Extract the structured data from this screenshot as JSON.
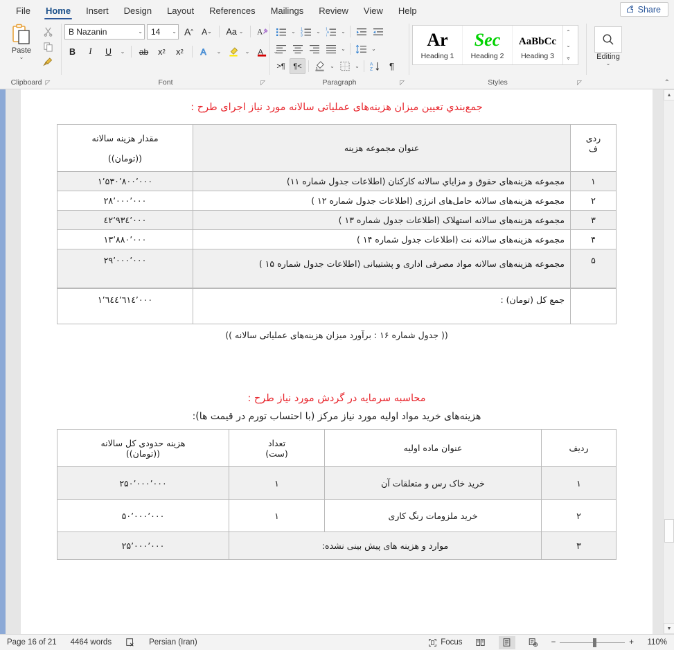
{
  "window": {
    "share_label": "Share",
    "share_icon": "share-person-icon"
  },
  "ribbon": {
    "tabs": [
      {
        "label": "File",
        "active": false
      },
      {
        "label": "Home",
        "active": true
      },
      {
        "label": "Insert",
        "active": false
      },
      {
        "label": "Design",
        "active": false
      },
      {
        "label": "Layout",
        "active": false
      },
      {
        "label": "References",
        "active": false
      },
      {
        "label": "Mailings",
        "active": false
      },
      {
        "label": "Review",
        "active": false
      },
      {
        "label": "View",
        "active": false
      },
      {
        "label": "Help",
        "active": false
      }
    ],
    "clipboard": {
      "group_label": "Clipboard",
      "paste_label": "Paste",
      "cut_icon": "scissors-icon",
      "copy_icon": "copy-icon",
      "format_painter_icon": "format-painter-icon",
      "dialog_launcher_icon": "dialog-launcher-icon"
    },
    "font": {
      "group_label": "Font",
      "font_name": "B Nazanin",
      "font_size": "14",
      "grow_font_icon": "grow-font-icon",
      "shrink_font_icon": "shrink-font-icon",
      "change_case_label": "Aa",
      "clear_formatting_icon": "clear-formatting-icon",
      "bold_label": "B",
      "italic_label": "I",
      "underline_label": "U",
      "strikethrough_label": "ab",
      "subscript_label": "x",
      "superscript_label": "x",
      "text_effects_icon": "text-effects-icon",
      "highlight_icon": "highlight-color-icon",
      "font_color_icon": "font-color-icon",
      "highlight_color": "#ffe900",
      "font_color": "#d40000",
      "dialog_launcher_icon": "dialog-launcher-icon"
    },
    "paragraph": {
      "group_label": "Paragraph",
      "bullets_icon": "bullets-icon",
      "numbering_icon": "numbering-icon",
      "multilevel_icon": "multilevel-list-icon",
      "increase_indent_icon": "increase-indent-icon",
      "decrease_indent_icon": "decrease-indent-icon",
      "align_left_icon": "align-left-icon",
      "align_center_icon": "align-center-icon",
      "align_right_icon": "align-right-icon",
      "justify_icon": "justify-icon",
      "line_spacing_icon": "line-spacing-icon",
      "ltr_icon": "left-to-right-icon",
      "rtl_icon": "right-to-left-icon",
      "rtl_active": true,
      "shading_icon": "shading-icon",
      "borders_icon": "borders-icon",
      "sort_icon": "sort-az-icon",
      "show_marks_icon": "pilcrow-icon",
      "dialog_launcher_icon": "dialog-launcher-icon"
    },
    "styles": {
      "group_label": "Styles",
      "items": [
        {
          "preview": "Ar",
          "name": "Heading 1",
          "color": "#000000"
        },
        {
          "preview": "Sec",
          "name": "Heading 2",
          "color": "#00d200"
        },
        {
          "preview": "AaBbCc",
          "name": "Heading 3",
          "color": "#000000"
        }
      ],
      "scroll_up_icon": "chevron-up-icon",
      "scroll_down_icon": "chevron-down-icon",
      "more_icon": "more-styles-icon",
      "dialog_launcher_icon": "dialog-launcher-icon"
    },
    "editing": {
      "group_label": "Editing",
      "find_icon": "magnifier-icon",
      "dropdown_icon": "chevron-down-icon"
    },
    "collapse_ribbon_icon": "chevron-up-icon"
  },
  "document": {
    "section1": {
      "heading": "جمع‌بندي تعیین میزان هزینه‌های عملیاتی سالانه مورد نیاز اجرای طرح :",
      "table": {
        "headers": {
          "index": "ردیف",
          "title": "عنوان مجموعه  هزینه",
          "value": "مقدار هزینه سالانه\n((تومان))"
        },
        "header_index": "ردی",
        "header_index2": "ف",
        "header_title": "عنوان مجموعه  هزینه",
        "header_value_line1": "مقدار هزینه سالانه",
        "header_value_line2": "((تومان))",
        "rows": [
          {
            "index": "۱",
            "title": "مجموعه هزینه‌های حقوق و مزایاي سالانه کارکنان (اطلاعات جدول شماره ۱۱)",
            "value": "۱٬۵۳۰٬۸۰۰٬۰۰۰"
          },
          {
            "index": "۲",
            "title": "مجموعه هزینه‌های سالانه حامل‌های انرژی (اطلاعات جدول شماره ۱۲ )",
            "value": "۲۸٬۰۰۰٬۰۰۰"
          },
          {
            "index": "۳",
            "title": "مجموعه هزینه‌های سالانه استهلاک (اطلاعات جدول شماره ۱۳ )",
            "value": "٤۲٬۹۳٤٬۰۰۰"
          },
          {
            "index": "۴",
            "title": "مجموعه هزینه‌های سالانه نت (اطلاعات جدول شماره ۱۴ )",
            "value": "۱۳٬۸۸۰٬۰۰۰"
          },
          {
            "index": "۵",
            "title": "مجموعه هزینه‌های سالانه مواد مصرفی اداری و پشتیبانی (اطلاعات جدول شماره ۱۵ )",
            "value": "۲۹٬۰۰۰٬۰۰۰"
          }
        ],
        "total_label": "جمع کل (تومان) :",
        "total_value": "۱٬٦٤٤٬٦۱٤٬۰۰۰"
      },
      "caption": "(( جدول شماره ۱۶ : برآورد میزان هزینه‌های عملیاتی سالانه ))"
    },
    "section2": {
      "heading": "محاسبه سرمایه در گردش مورد نیاز طرح :",
      "subheading": "هزینه‌های خرید مواد اولیه مورد نیاز مرکز (با احتساب تورم در قیمت ها):",
      "table": {
        "header_index": "ردیف",
        "header_title": "عنوان ماده اولیه",
        "header_qty_line1": "تعداد",
        "header_qty_line2": "(ست)",
        "header_value_line1": "هزینه حدودی کل سالانه",
        "header_value_line2": "((تومان))",
        "rows": [
          {
            "index": "۱",
            "title": "خرید خاک رس و متعلقات آن",
            "qty": "۱",
            "value": "۲۵۰٬۰۰۰٬۰۰۰"
          },
          {
            "index": "۲",
            "title": "خرید ملزومات رنگ کاری",
            "qty": "۱",
            "value": "۵۰٬۰۰۰٬۰۰۰"
          },
          {
            "index": "۳",
            "title": "موارد و هزینه های پیش بینی نشده:",
            "qty": "",
            "value": "۲۵٬۰۰۰٬۰۰۰"
          }
        ]
      }
    }
  },
  "statusbar": {
    "page_info": "Page 16 of 21",
    "word_count": "4464 words",
    "proofing_icon": "proofing-errors-icon",
    "language": "Persian (Iran)",
    "focus_label": "Focus",
    "focus_icon": "focus-mode-icon",
    "read_mode_icon": "read-mode-icon",
    "print_layout_icon": "print-layout-icon",
    "web_layout_icon": "web-layout-icon",
    "zoom_out_label": "−",
    "zoom_in_label": "+",
    "zoom_level": "110%"
  },
  "scrollbar": {
    "up_icon": "scroll-up-icon",
    "down_icon": "scroll-down-icon",
    "thumb": "scroll-thumb"
  }
}
